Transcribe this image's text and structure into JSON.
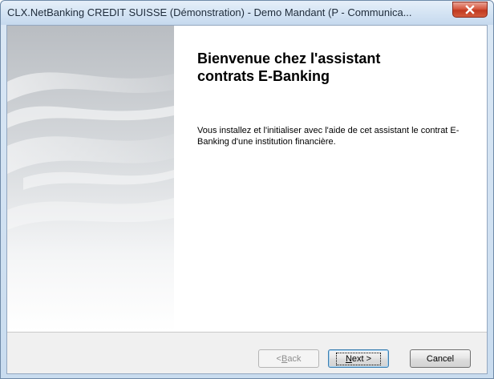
{
  "window": {
    "title": "CLX.NetBanking CREDIT SUISSE (Démonstration) - Demo Mandant (P - Communica..."
  },
  "wizard": {
    "heading_line1": "Bienvenue chez l'assistant",
    "heading_line2": "contrats E-Banking",
    "description": "Vous installez et l'initialiser avec l'aide de cet assistant le contrat E-Banking d'une institution financière."
  },
  "buttons": {
    "back_prefix": "< ",
    "back_accel": "B",
    "back_rest": "ack",
    "next_accel": "N",
    "next_rest": "ext >",
    "cancel": "Cancel"
  },
  "icons": {
    "close": "close-icon"
  },
  "colors": {
    "close_button": "#c13a20",
    "button_bar": "#f0f0f0",
    "title_bar": "#d3e3f3"
  }
}
